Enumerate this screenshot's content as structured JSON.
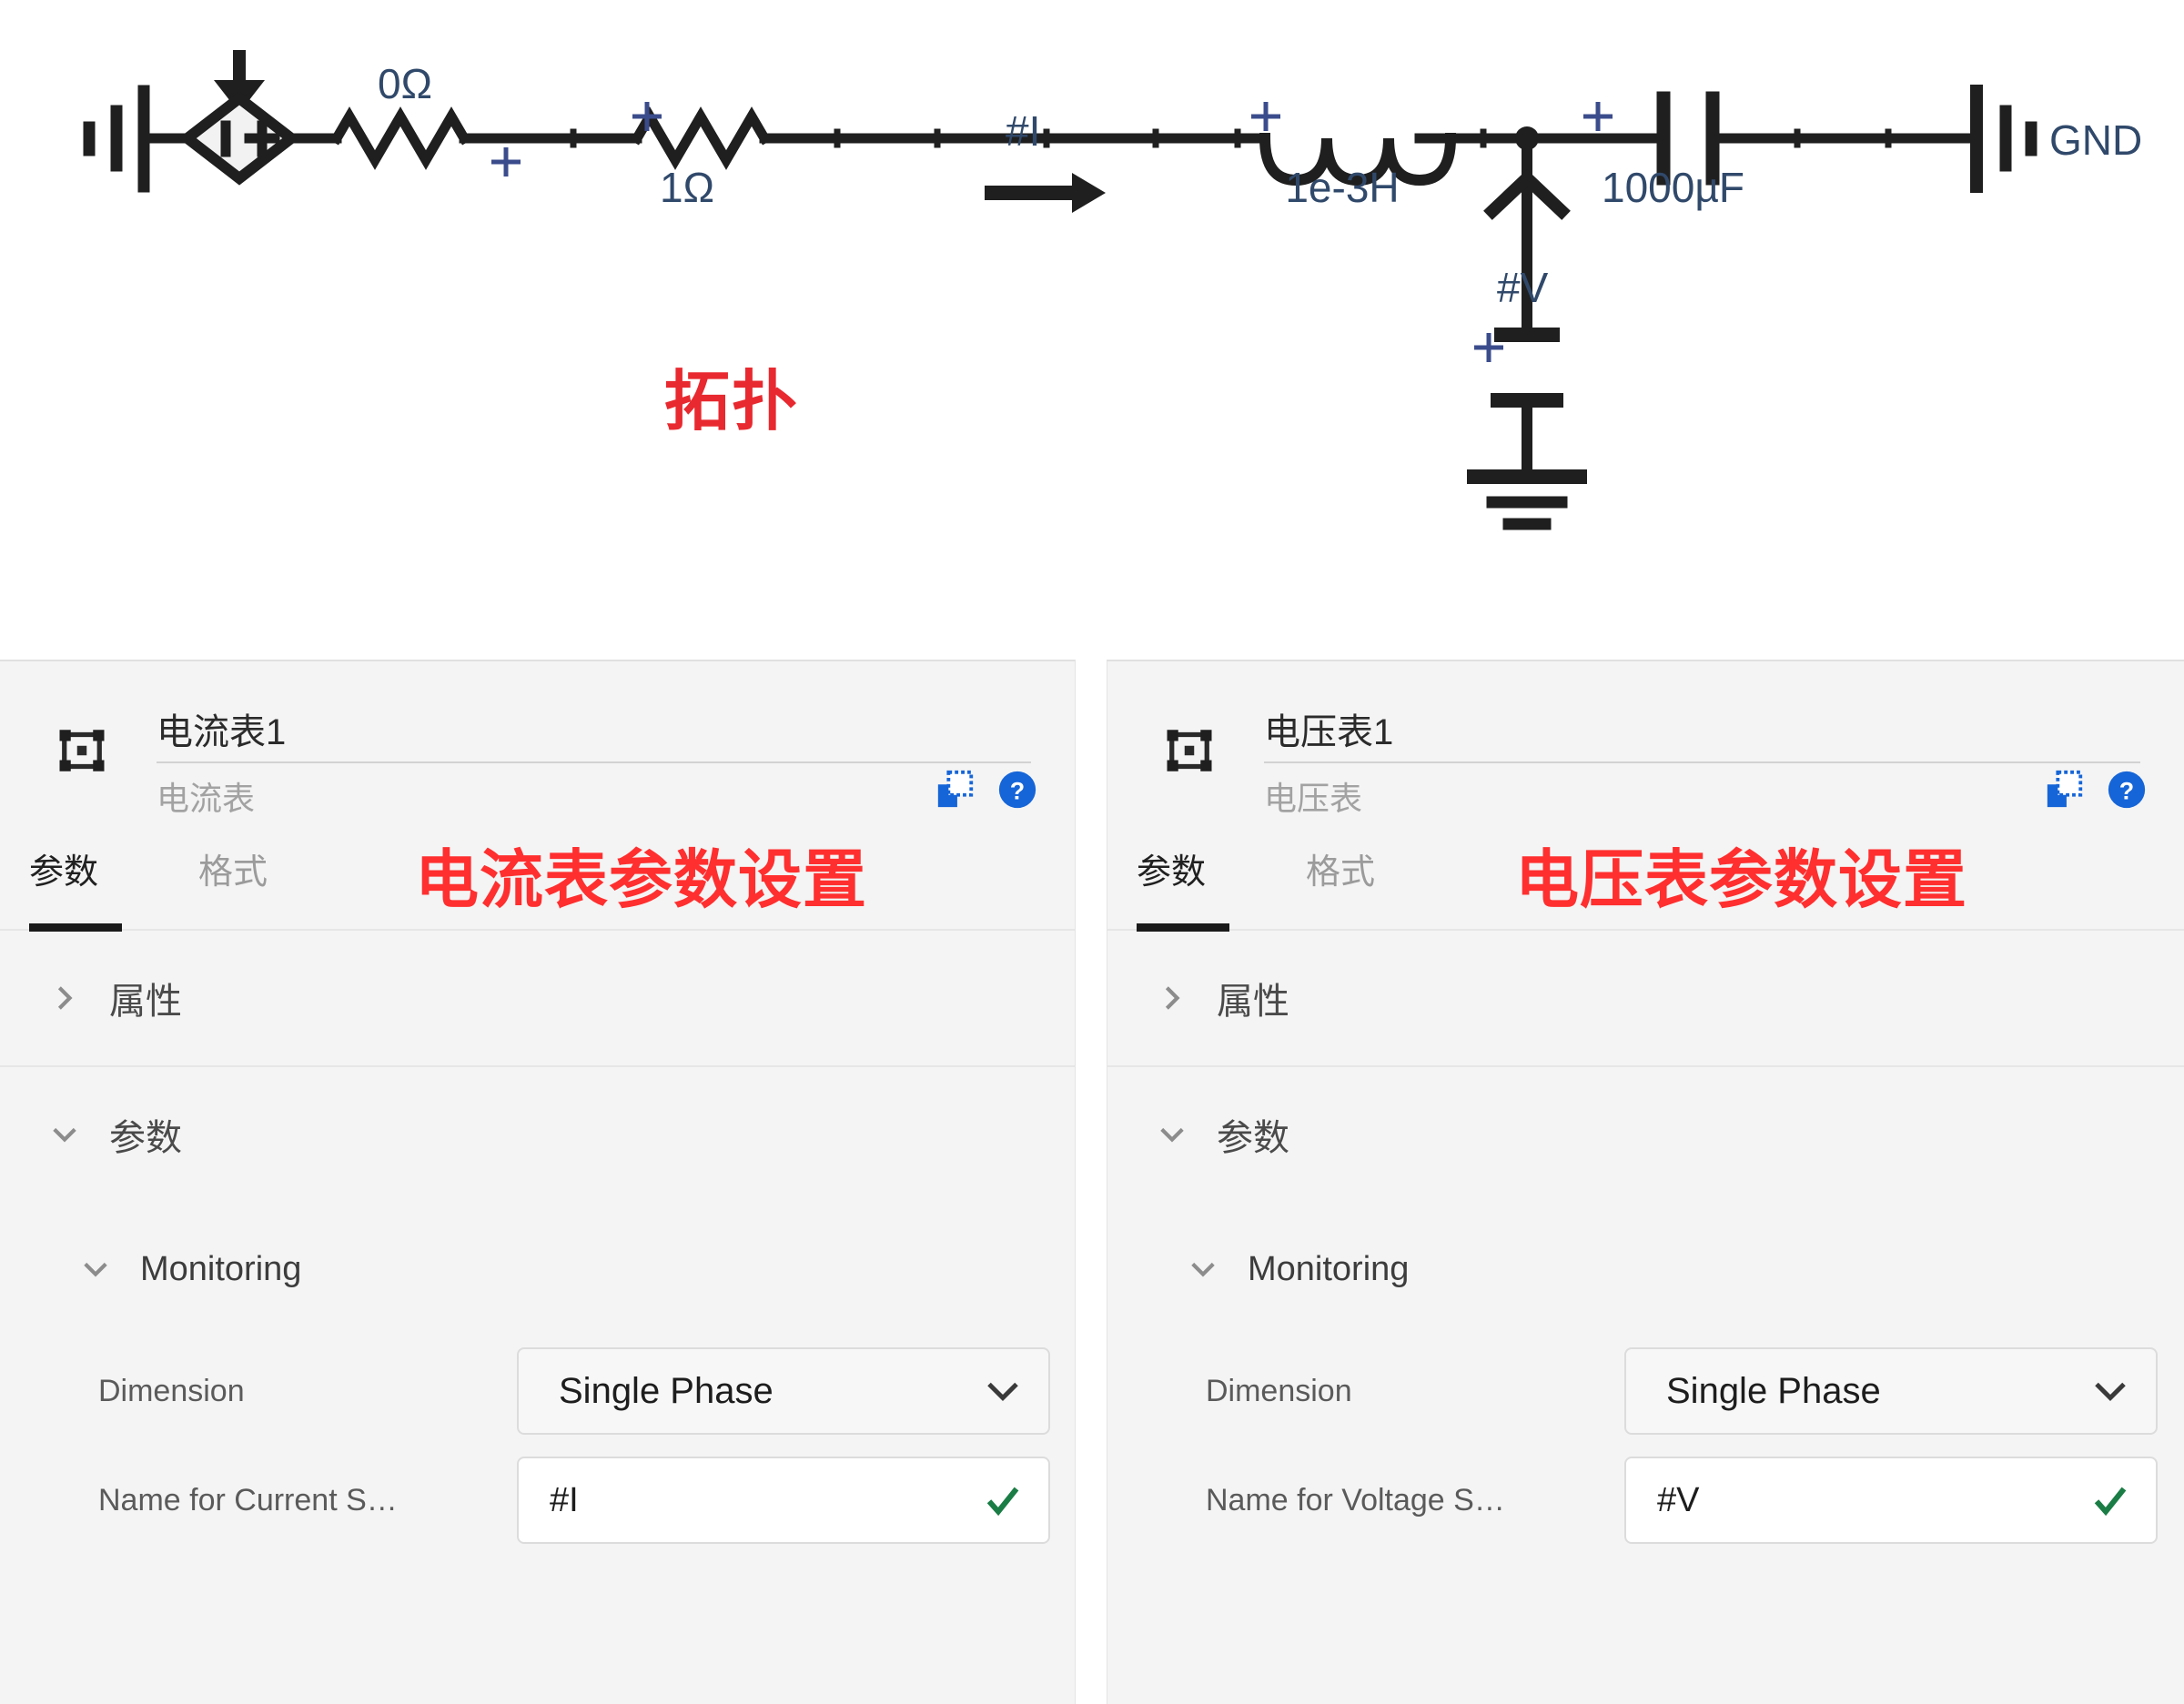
{
  "schematic": {
    "caption": "拓扑",
    "caption_color": "#e8292f",
    "labels": {
      "r0": "0Ω",
      "r1": "1Ω",
      "current_probe": "#I",
      "inductor": "1e-3H",
      "capacitor": "1000µF",
      "voltage_probe": "#V",
      "ground_net": "GND",
      "plus": "+"
    },
    "components": [
      {
        "name": "controlled-current-source",
        "label": ""
      },
      {
        "name": "resistor",
        "label": "0Ω"
      },
      {
        "name": "resistor",
        "label": "1Ω"
      },
      {
        "name": "current-meter",
        "label": "#I"
      },
      {
        "name": "inductor",
        "label": "1e-3H"
      },
      {
        "name": "voltage-meter",
        "label": "#V"
      },
      {
        "name": "capacitor",
        "label": "1000µF"
      },
      {
        "name": "ground",
        "label": "GND"
      }
    ]
  },
  "panels": [
    {
      "id": "current-meter",
      "title": "电流表1",
      "subtitle": "电流表",
      "annotation": "电流表参数设置",
      "annotation_color": "#ff2f2f",
      "actions": [
        {
          "name": "duplicate-icon",
          "color": "#1565d8"
        },
        {
          "name": "help-icon",
          "color": "#1565d8"
        }
      ],
      "tabs": [
        {
          "label": "参数",
          "active": true
        },
        {
          "label": "格式",
          "active": false
        }
      ],
      "sections": [
        {
          "label": "属性",
          "expanded": false
        },
        {
          "label": "参数",
          "expanded": true
        }
      ],
      "subsection": {
        "label": "Monitoring",
        "expanded": true
      },
      "fields": [
        {
          "label": "Dimension",
          "type": "select",
          "value": "Single Phase",
          "adorn": "chevron-down-icon"
        },
        {
          "label": "Name for Current S…",
          "type": "text",
          "value": "#I",
          "adorn": "check-icon",
          "adorn_color": "#1a7d45"
        }
      ]
    },
    {
      "id": "voltage-meter",
      "title": "电压表1",
      "subtitle": "电压表",
      "annotation": "电压表参数设置",
      "annotation_color": "#ff2f2f",
      "actions": [
        {
          "name": "duplicate-icon",
          "color": "#1565d8"
        },
        {
          "name": "help-icon",
          "color": "#1565d8"
        }
      ],
      "tabs": [
        {
          "label": "参数",
          "active": true
        },
        {
          "label": "格式",
          "active": false
        }
      ],
      "sections": [
        {
          "label": "属性",
          "expanded": false
        },
        {
          "label": "参数",
          "expanded": true
        }
      ],
      "subsection": {
        "label": "Monitoring",
        "expanded": true
      },
      "fields": [
        {
          "label": "Dimension",
          "type": "select",
          "value": "Single Phase",
          "adorn": "chevron-down-icon"
        },
        {
          "label": "Name for Voltage S…",
          "type": "text",
          "value": "#V",
          "adorn": "check-icon",
          "adorn_color": "#1a7d45"
        }
      ]
    }
  ]
}
